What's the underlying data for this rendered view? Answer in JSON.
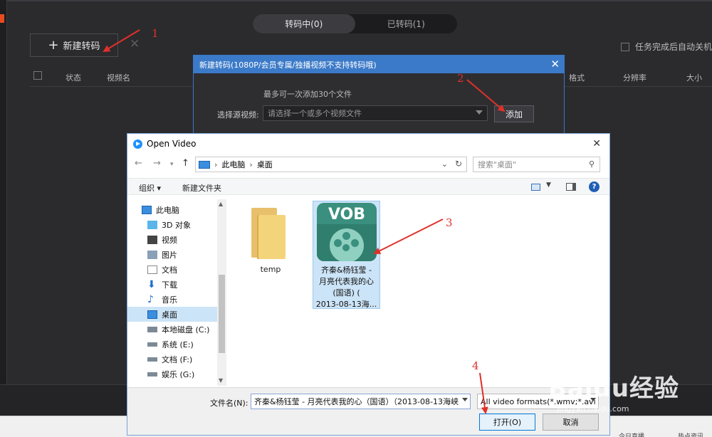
{
  "app": {
    "tabs": [
      {
        "label": "转码中(0)",
        "active": true
      },
      {
        "label": "已转码(1)",
        "active": false
      }
    ],
    "new_button": "新建转码",
    "close_icon": "close-icon",
    "auto_shutdown": "任务完成后自动关机",
    "columns": [
      "状态",
      "视频名",
      "格式",
      "分辨率",
      "大小"
    ],
    "taskbar": {
      "live": "今日直播",
      "hot": "热点资讯"
    }
  },
  "new_dialog": {
    "title": "新建转码(1080P/会员专属/独播视频不支持转码哦)",
    "hint": "最多可一次添加30个文件",
    "source_label": "选择源视频:",
    "source_placeholder": "请选择一个或多个视频文件",
    "add_button": "添加"
  },
  "open_dialog": {
    "title": "Open Video",
    "breadcrumb": [
      "此电脑",
      "桌面"
    ],
    "search_placeholder": "搜索\"桌面\"",
    "organize": "组织 ▾",
    "new_folder": "新建文件夹",
    "tree": [
      {
        "label": "此电脑",
        "icon": "computer-icon"
      },
      {
        "label": "3D 对象",
        "icon": "3d-objects-icon"
      },
      {
        "label": "视频",
        "icon": "video-icon"
      },
      {
        "label": "图片",
        "icon": "pictures-icon"
      },
      {
        "label": "文档",
        "icon": "documents-icon"
      },
      {
        "label": "下载",
        "icon": "download-icon"
      },
      {
        "label": "音乐",
        "icon": "music-icon"
      },
      {
        "label": "桌面",
        "icon": "desktop-icon",
        "selected": true
      },
      {
        "label": "本地磁盘 (C:)",
        "icon": "drive-icon"
      },
      {
        "label": "系统 (E:)",
        "icon": "drive-icon"
      },
      {
        "label": "文档 (F:)",
        "icon": "drive-icon"
      },
      {
        "label": "娱乐 (G:)",
        "icon": "drive-icon"
      }
    ],
    "files": [
      {
        "name": "temp",
        "type": "folder"
      },
      {
        "badge": "VOB",
        "name_lines": [
          "齐秦&杨钰莹 -",
          "月亮代表我的心",
          "(国语)  (",
          "2013-08-13海..."
        ],
        "type": "vob",
        "selected": true
      }
    ],
    "filename_label": "文件名(N):",
    "filename_value": "齐秦&杨钰莹 - 月亮代表我的心（国语）（2013-08-13海峡",
    "filetype_value": "All video formats(*.wmv;*.avi",
    "open_button": "打开(O)",
    "cancel_button": "取消"
  },
  "annotations": [
    "1",
    "2",
    "3",
    "4"
  ],
  "watermark": {
    "text": "Baidu经验",
    "url": "jingyan.baidu.com"
  },
  "colors": {
    "accent": "#3b7ac8",
    "annotation": "#e0302a",
    "selection": "#cce4f7"
  }
}
